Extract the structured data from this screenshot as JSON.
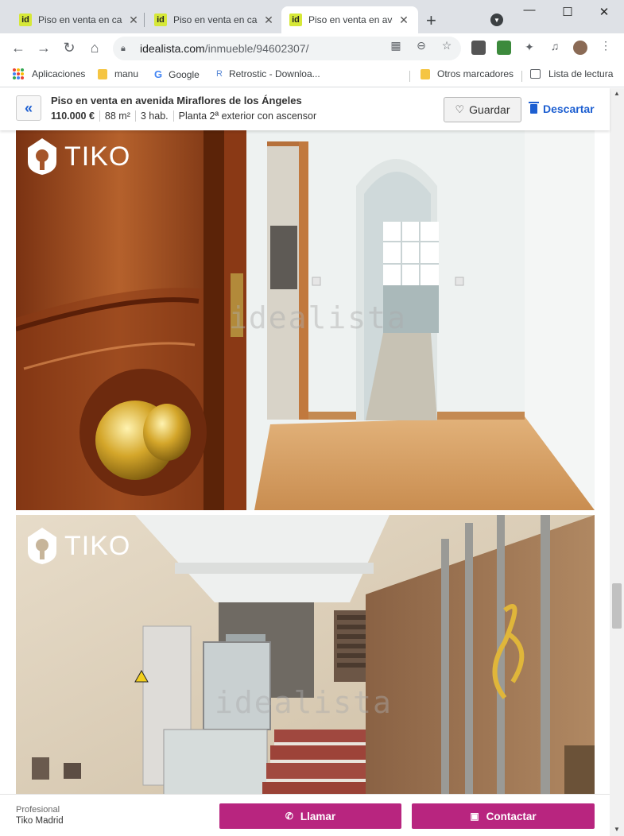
{
  "browser": {
    "tabs": [
      {
        "title": "Piso en venta en calle",
        "favicon": "id",
        "active": false
      },
      {
        "title": "Piso en venta en calle",
        "favicon": "id",
        "active": false
      },
      {
        "title": "Piso en venta en avenida",
        "favicon": "id",
        "active": true
      }
    ],
    "new_tab_label": "+",
    "url_host": "idealista.com",
    "url_path": "/inmueble/94602307/"
  },
  "bookmarks": {
    "apps": "Aplicaciones",
    "items": [
      "manu",
      "Google",
      "Retrostic - Downloa..."
    ],
    "other": "Otros marcadores",
    "reading_list": "Lista de lectura"
  },
  "listing": {
    "title": "Piso en venta en avenida Miraflores de los Ángeles",
    "price": "110.000 €",
    "size": "88 m²",
    "rooms": "3 hab.",
    "floor": "Planta 2ª exterior con ascensor",
    "save_label": "Guardar",
    "discard_label": "Descartar"
  },
  "photos": {
    "watermark": "idealista",
    "agency_logo": "TIKO"
  },
  "contact": {
    "type_label": "Profesional",
    "agency_name": "Tiko Madrid",
    "call_label": "Llamar",
    "contact_label": "Contactar"
  },
  "colors": {
    "accent_blue": "#1d5fd1",
    "cta_magenta": "#b8257f",
    "favicon_yellow": "#d6e838"
  }
}
